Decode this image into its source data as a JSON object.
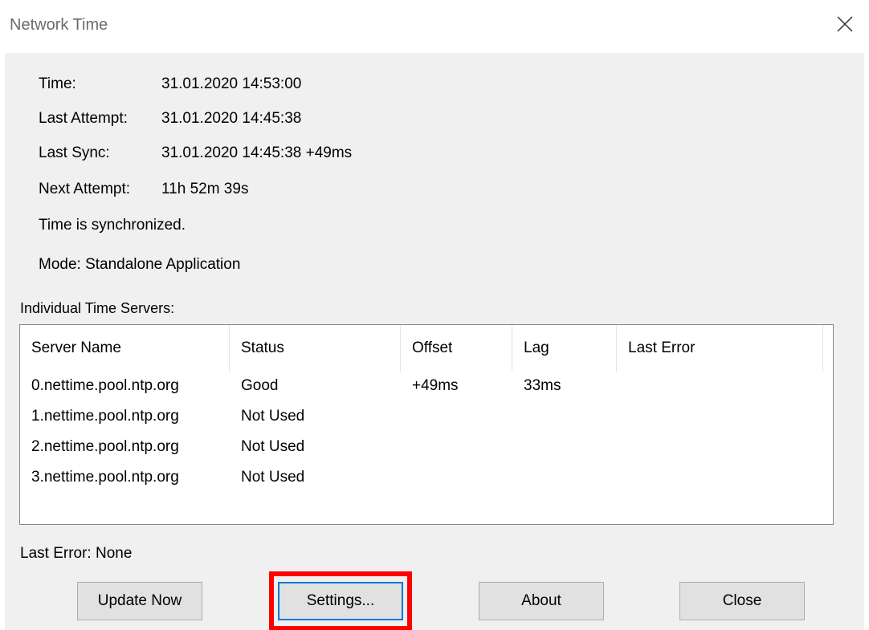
{
  "window": {
    "title": "Network Time",
    "close_icon": "close-icon"
  },
  "info": {
    "time_label": "Time:",
    "time_value": "31.01.2020 14:53:00",
    "last_attempt_label": "Last Attempt:",
    "last_attempt_value": "31.01.2020 14:45:38",
    "last_sync_label": "Last Sync:",
    "last_sync_value": "31.01.2020 14:45:38 +49ms",
    "next_attempt_label": "Next Attempt:",
    "next_attempt_value": "11h 52m 39s",
    "status_text": "Time is synchronized.",
    "mode_text": "Mode: Standalone Application"
  },
  "servers": {
    "group_label": "Individual Time Servers:",
    "columns": [
      "Server Name",
      "Status",
      "Offset",
      "Lag",
      "Last Error"
    ],
    "rows": [
      {
        "name": "0.nettime.pool.ntp.org",
        "status": "Good",
        "offset": "+49ms",
        "lag": "33ms",
        "last_error": ""
      },
      {
        "name": "1.nettime.pool.ntp.org",
        "status": "Not Used",
        "offset": "",
        "lag": "",
        "last_error": ""
      },
      {
        "name": "2.nettime.pool.ntp.org",
        "status": "Not Used",
        "offset": "",
        "lag": "",
        "last_error": ""
      },
      {
        "name": "3.nettime.pool.ntp.org",
        "status": "Not Used",
        "offset": "",
        "lag": "",
        "last_error": ""
      }
    ]
  },
  "last_error_text": "Last Error:  None",
  "buttons": {
    "update_now": "Update Now",
    "settings": "Settings...",
    "about": "About",
    "close": "Close"
  },
  "highlight_color": "#ff0000",
  "focus_color": "#0078d7"
}
